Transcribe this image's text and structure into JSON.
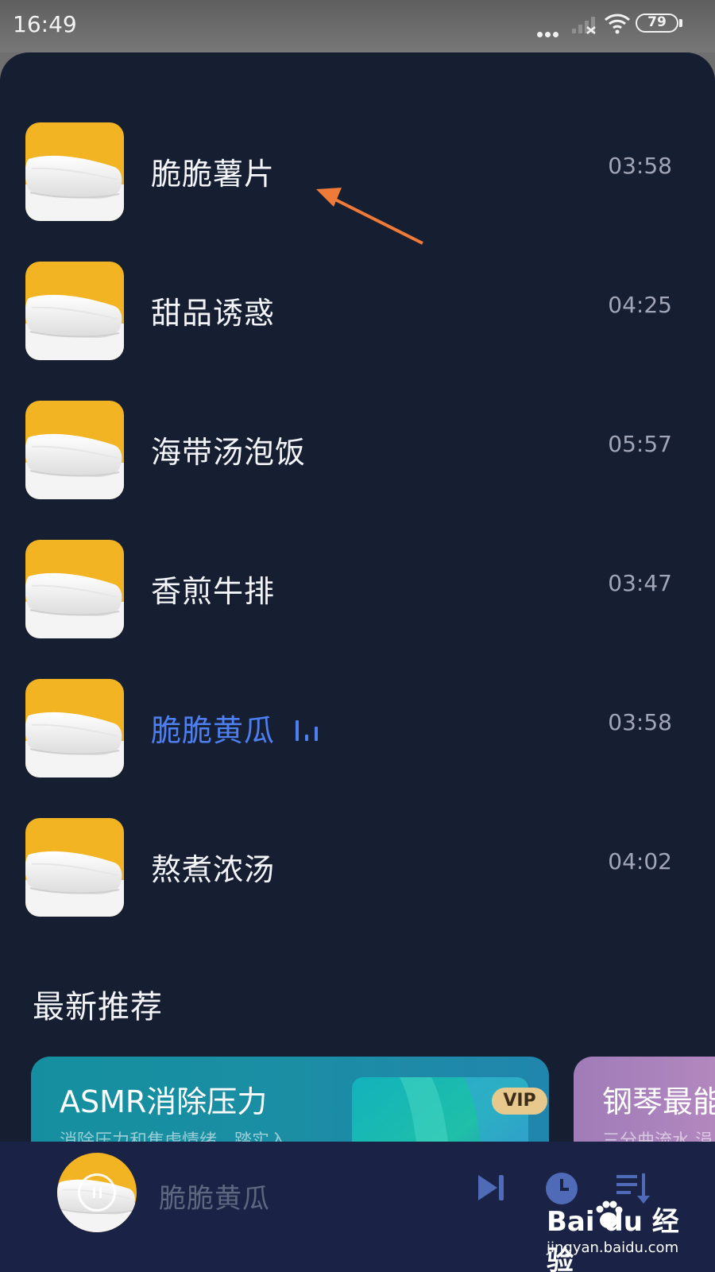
{
  "status_bar": {
    "time": "16:49",
    "battery": "79"
  },
  "tracks": [
    {
      "title": "脆脆薯片",
      "duration": "03:58",
      "playing": false
    },
    {
      "title": "甜品诱惑",
      "duration": "04:25",
      "playing": false
    },
    {
      "title": "海带汤泡饭",
      "duration": "05:57",
      "playing": false
    },
    {
      "title": "香煎牛排",
      "duration": "03:47",
      "playing": false
    },
    {
      "title": "脆脆黄瓜",
      "duration": "03:58",
      "playing": true
    },
    {
      "title": "熬煮浓汤",
      "duration": "04:02",
      "playing": false
    }
  ],
  "section": {
    "title": "最新推荐"
  },
  "cards": [
    {
      "title": "ASMR消除压力",
      "subtitle": "消除压力和焦虑情绪，踏实入",
      "badge": "VIP"
    },
    {
      "title": "钢琴最能",
      "subtitle": "三分曲流水 涓"
    }
  ],
  "player": {
    "title": "脆脆黄瓜"
  },
  "watermark": {
    "brand": "Bai du 经验",
    "url": "jingyan.baidu.com"
  },
  "colors": {
    "background": "#161e32",
    "playing_accent": "#4d7ff0",
    "annotation_arrow": "#f07a37",
    "player_bar": "#1a2346"
  }
}
